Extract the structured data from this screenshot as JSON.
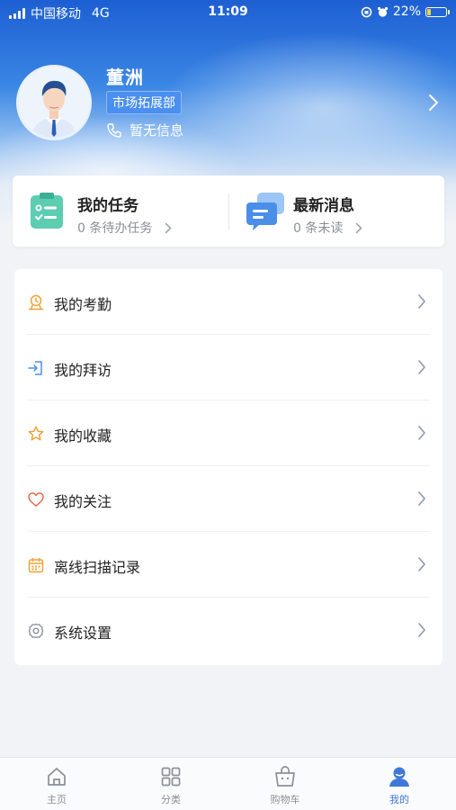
{
  "status_bar": {
    "carrier": "中国移动",
    "network": "4G",
    "time": "11:09",
    "battery": "22%",
    "battery_level": 0.22
  },
  "profile": {
    "name": "董洲",
    "department": "市场拓展部",
    "phone": "暂无信息"
  },
  "quick": {
    "tasks": {
      "title": "我的任务",
      "sub": "0 条待办任务"
    },
    "messages": {
      "title": "最新消息",
      "sub": "0 条未读"
    }
  },
  "menu": {
    "items": [
      {
        "label": "我的考勤",
        "icon": "attendance-icon"
      },
      {
        "label": "我的拜访",
        "icon": "visit-icon"
      },
      {
        "label": "我的收藏",
        "icon": "star-icon"
      },
      {
        "label": "我的关注",
        "icon": "heart-icon"
      },
      {
        "label": "离线扫描记录",
        "icon": "calendar-icon"
      },
      {
        "label": "系统设置",
        "icon": "gear-icon"
      }
    ]
  },
  "tabbar": {
    "items": [
      {
        "label": "主页",
        "icon": "home-icon"
      },
      {
        "label": "分类",
        "icon": "grid-icon"
      },
      {
        "label": "购物车",
        "icon": "basket-icon"
      },
      {
        "label": "我的",
        "icon": "user-icon"
      }
    ],
    "active": "我的"
  },
  "colors": {
    "accent": "#3f78d8",
    "icon_orange": "#f0a238",
    "icon_blue": "#4a8ee8",
    "icon_red": "#e66a4a",
    "icon_gray": "#8a8f99"
  }
}
